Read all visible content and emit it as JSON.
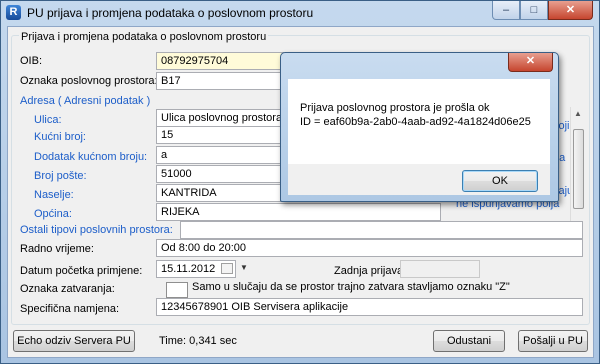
{
  "window": {
    "title": "PU prijava i promjena podataka o poslovnom prostoru",
    "app_icon": "R",
    "controls": {
      "minimize": "–",
      "maximize": "□",
      "close": "✕"
    }
  },
  "form": {
    "group_title": "Prijava i promjena podataka o poslovnom prostoru",
    "oib_label": "OIB:",
    "oib_value": "08792975704",
    "oznaka_label": "Oznaka poslovnog prostora:",
    "oznaka_value": "B17",
    "adresa_label": "Adresa ( Adresni podatak )",
    "ulica_label": "Ulica:",
    "ulica_value": "Ulica poslovnog prostora",
    "kucni_broj_label": "Kućni broj:",
    "kucni_broj_value": "15",
    "dodatak_label": "Dodatak kućnom broju:",
    "dodatak_value": "a",
    "broj_poste_label": "Broj pošte:",
    "broj_poste_value": "51000",
    "naselje_label": "Naselje:",
    "naselje_value": "KANTRIDA",
    "opcina_label": "Općina:",
    "opcina_value": "RIJEKA",
    "ostali_label": "Ostali tipovi poslovnih prostora:",
    "ostali_value": "",
    "radno_label": "Radno vrijeme:",
    "radno_value": "Od 8:00 do 20:00",
    "datum_label": "Datum početka primjene:",
    "datum_value": "15.11.2012",
    "zadnja_label": "Zadnja prijava:",
    "zadnja_value": "",
    "zatvaranje_label": "Oznaka zatvaranja:",
    "zatvaranje_note": "Samo u slučaju da se prostor trajno zatvara stavljamo oznaku \"Z\"",
    "specificna_label": "Specifična namjena:",
    "specificna_value": "12345678901 OIB Servisera aplikacije",
    "side_list_lines": [
      "e",
      "koji",
      "",
      "na",
      "caju",
      "ne ispunjavamo polja"
    ]
  },
  "bottom": {
    "echo_button": "Echo odziv Servera PU",
    "time_text": "Time: 0,341 sec",
    "cancel_button": "Odustani",
    "send_button": "Pošalji u PU"
  },
  "dialog": {
    "close": "✕",
    "line1": "Prijava poslovnog prostora je prošla ok",
    "line2": "ID = eaf60b9a-2ab0-4aab-ad92-4a1824d06e25",
    "ok_button": "OK"
  }
}
